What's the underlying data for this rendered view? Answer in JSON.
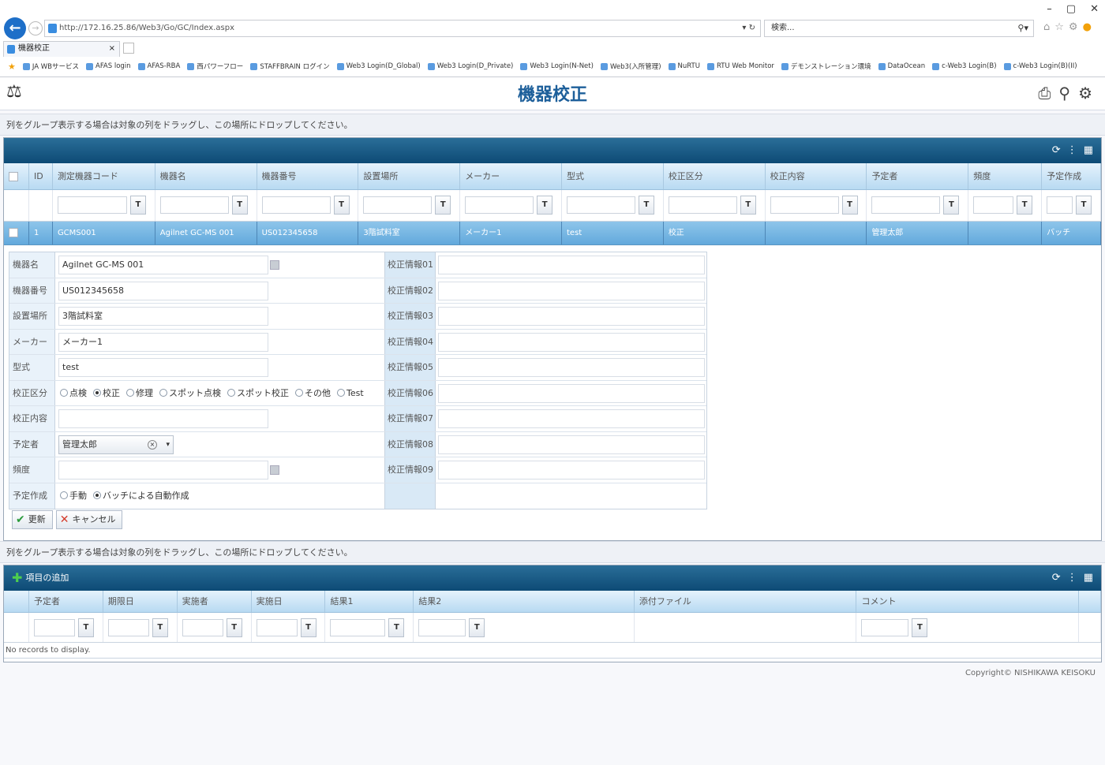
{
  "browser": {
    "window_controls": [
      "–",
      "▢",
      "✕"
    ],
    "url": "http://172.16.25.86/Web3/Go/GC/Index.aspx",
    "url_controls": "▾ ↻",
    "search_text": "検索...",
    "search_icon": "⚲▾",
    "tab_title": "機器校正",
    "tab_close": "×",
    "favorites": [
      "JA WBサービス",
      "AFAS login",
      "AFAS-RBA",
      "西パワーフロー",
      "STAFFBRAIN ログイン",
      "Web3 Login(D_Global)",
      "Web3 Login(D_Private)",
      "Web3 Login(N-Net)",
      "Web3(入所管理)",
      "NuRTU",
      "RTU Web Monitor",
      "デモンストレーション環境",
      "DataOcean",
      "c-Web3 Login(B)",
      "c-Web3 Login(B)(II)"
    ]
  },
  "app": {
    "logo": "⚖",
    "title": "機器校正",
    "header_icons": [
      "⎙",
      "⚲",
      "⚙"
    ]
  },
  "group_hint": "列をグループ表示する場合は対象の列をドラッグし、この場所にドロップしてください。",
  "grid": {
    "bar_icons": [
      "⟳",
      "⋮",
      "▦"
    ],
    "columns": [
      "",
      "ID",
      "測定機器コード",
      "機器名",
      "機器番号",
      "設置場所",
      "メーカー",
      "型式",
      "校正区分",
      "校正内容",
      "予定者",
      "頻度",
      "予定作成"
    ],
    "filter_icon": "T",
    "row": {
      "id": "1",
      "code": "GCMS001",
      "name": "Agilnet GC-MS 001",
      "number": "US012345658",
      "location": "3階試料室",
      "maker": "メーカー1",
      "model": "test",
      "cal_type": "校正",
      "cal_content": "",
      "person": "管理太郎",
      "freq": "",
      "schedule": "バッチ"
    }
  },
  "form": {
    "labels_left": [
      "機器名",
      "機器番号",
      "設置場所",
      "メーカー",
      "型式",
      "校正区分",
      "校正内容",
      "予定者",
      "頻度",
      "予定作成"
    ],
    "values": {
      "name": "Agilnet GC-MS 001",
      "number": "US012345658",
      "location": "3階試料室",
      "maker": "メーカー1",
      "model": "test",
      "cal_content": "",
      "person": "管理太郎",
      "freq": ""
    },
    "cal_type_options": [
      "点検",
      "校正",
      "修理",
      "スポット点検",
      "スポット校正",
      "その他",
      "Test"
    ],
    "cal_type_selected": "校正",
    "schedule_options": [
      "手動",
      "バッチによる自動作成"
    ],
    "schedule_selected": "バッチによる自動作成",
    "labels_right": [
      "校正情報01",
      "校正情報02",
      "校正情報03",
      "校正情報04",
      "校正情報05",
      "校正情報06",
      "校正情報07",
      "校正情報08",
      "校正情報09"
    ],
    "combo_clear": "×",
    "combo_drop": "▾",
    "update_label": "更新",
    "cancel_label": "キャンセル",
    "update_icon": "✔",
    "cancel_icon": "✕"
  },
  "sub": {
    "add_label": "項目の追加",
    "add_icon": "✚",
    "columns": [
      "予定者",
      "期限日",
      "実施者",
      "実施日",
      "結果1",
      "結果2",
      "添付ファイル",
      "コメント"
    ],
    "no_records": "No records to display."
  },
  "copyright": "Copyright© NISHIKAWA KEISOKU"
}
